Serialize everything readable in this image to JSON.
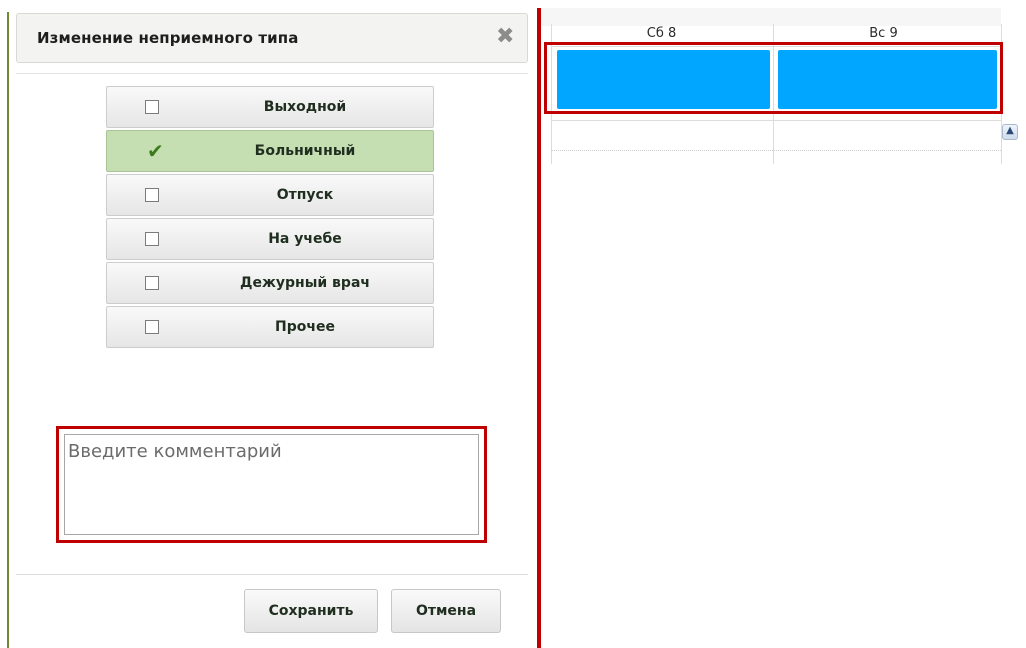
{
  "dialog": {
    "title": "Изменение неприемного типа",
    "close_glyph": "✖",
    "types": [
      {
        "label": "Выходной",
        "selected": false
      },
      {
        "label": "Больничный",
        "selected": true
      },
      {
        "label": "Отпуск",
        "selected": false
      },
      {
        "label": "На учебе",
        "selected": false
      },
      {
        "label": "Дежурный врач",
        "selected": false
      },
      {
        "label": "Прочее",
        "selected": false
      }
    ],
    "comment": {
      "placeholder": "Введите комментарий",
      "value": ""
    },
    "buttons": {
      "save": "Сохранить",
      "cancel": "Отмена"
    }
  },
  "calendar": {
    "days": [
      "Сб 8",
      "Вс 9"
    ],
    "slot_color": "#00a6ff",
    "highlight_color": "#c00000",
    "scroll_icon": "chevron-up-icon"
  }
}
